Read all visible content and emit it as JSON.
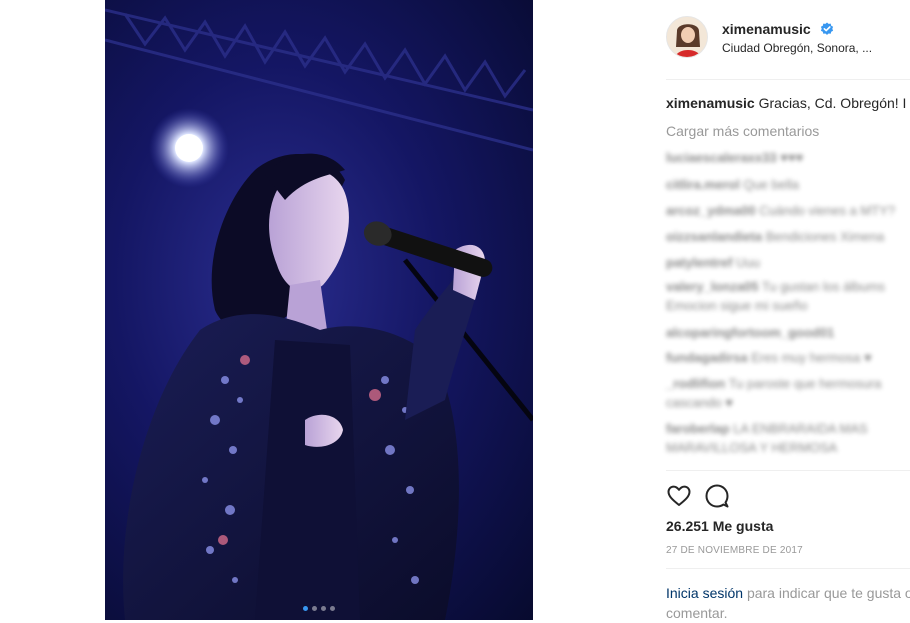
{
  "post": {
    "username": "ximenamusic",
    "location": "Ciudad Obregón, Sonora, ...",
    "caption_user": "ximenamusic",
    "caption_text": "Gracias, Cd. Obregón! I",
    "load_more": "Cargar más comentarios",
    "comments": [
      {
        "user": "luciaescaleraxx33",
        "text": "♥♥♥"
      },
      {
        "user": "citlira.merol",
        "text": "Que bella"
      },
      {
        "user": "arcoz_ydma00",
        "text": "Cuándo vienes a MTY?"
      },
      {
        "user": "oizzsanlandieta",
        "text": "Bendiciones Ximena"
      },
      {
        "user": "patylentref",
        "text": "Uuu"
      },
      {
        "user": "valery_lonza05",
        "text": "Tu gustan los álbums"
      },
      {
        "user": "",
        "text": "Emocion sigue mi sueño"
      },
      {
        "user": "alcoparingfortoom_good01",
        "text": ""
      },
      {
        "user": "fundagadirsa",
        "text": "Eres muy hermosa ♥"
      },
      {
        "user": "_rodlifion",
        "text": "Tu paroste que hermosura"
      },
      {
        "user": "",
        "text": "cascando ♥"
      },
      {
        "user": "faroberlap",
        "text": "LA ENBRARAIDA MAS"
      },
      {
        "user": "",
        "text": "MARAVILLOSA Y HERMOSA"
      }
    ],
    "likes": "26.251 Me gusta",
    "date": "27 DE NOVIEMBRE DE 2017",
    "login_link": "Inicia sesión",
    "login_text": "para indicar que te gusta o comentar.",
    "carousel_count": 4,
    "carousel_active": 1
  },
  "colors": {
    "verified": "#3897f0",
    "link": "#003569",
    "muted": "#999999",
    "stage_blue": "#141663"
  },
  "icons": [
    "verified-badge-icon",
    "heart-icon",
    "comment-icon"
  ]
}
